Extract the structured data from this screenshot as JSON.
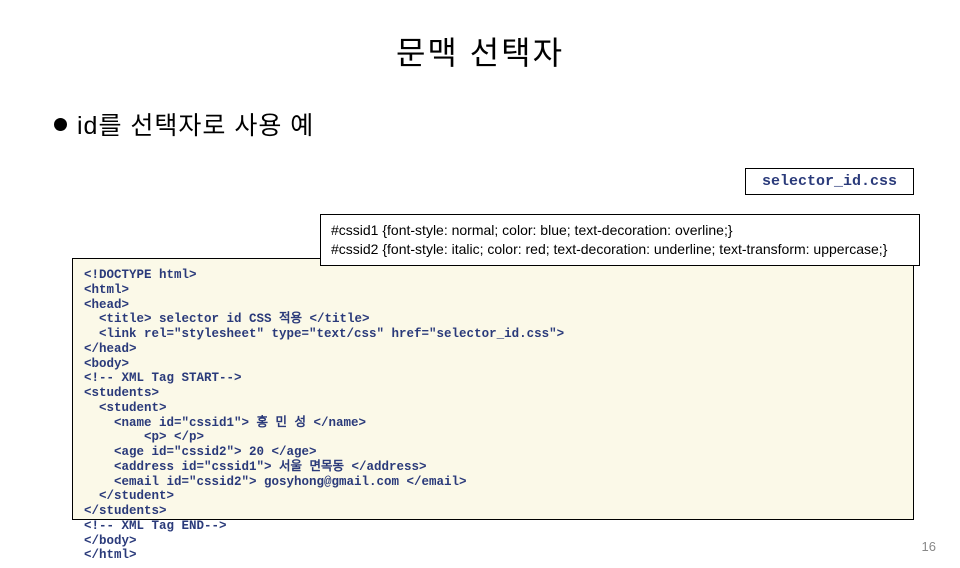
{
  "title": "문맥 선택자",
  "bullet": "id를 선택자로 사용 예",
  "css_filename": "selector_id.css",
  "css_rules": [
    "#cssid1 {font-style: normal; color: blue; text-decoration: overline;}",
    "#cssid2 {font-style: italic; color: red; text-decoration: underline; text-transform: uppercase;}"
  ],
  "html_code": "<!DOCTYPE html>\n<html>\n<head>\n  <title> selector id CSS 적용 </title>\n  <link rel=\"stylesheet\" type=\"text/css\" href=\"selector_id.css\">\n</head>\n<body>\n<!-- XML Tag START-->\n<students>\n  <student>\n    <name id=\"cssid1\"> 홍 민 성 </name>\n        <p> </p>\n    <age id=\"cssid2\"> 20 </age>\n    <address id=\"cssid1\"> 서울 면목동 </address>\n    <email id=\"cssid2\"> gosyhong@gmail.com </email>\n  </student>\n</students>\n<!-- XML Tag END-->\n</body>\n</html>",
  "page_number": "16"
}
